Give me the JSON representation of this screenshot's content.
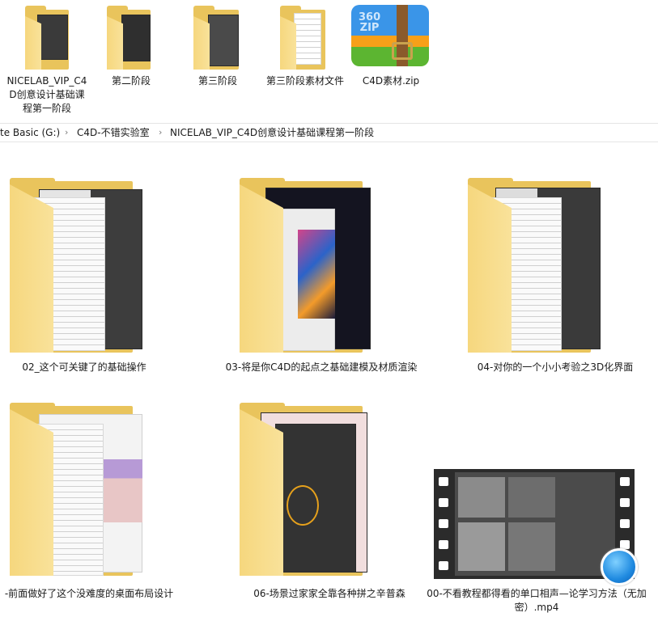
{
  "top_items": [
    {
      "label": "NICELAB_VIP_C4D创意设计基础课程第一阶段",
      "icon": "folder-icon"
    },
    {
      "label": "第二阶段",
      "icon": "folder-icon"
    },
    {
      "label": "第三阶段",
      "icon": "folder-icon"
    },
    {
      "label": "第三阶段素材文件",
      "icon": "folder-icon"
    },
    {
      "label": "C4D素材.zip",
      "icon": "zip-archive-icon"
    }
  ],
  "breadcrumb": {
    "drive": "te Basic (G:)",
    "folder1": "C4D-不错实验室",
    "folder2": "NICELAB_VIP_C4D创意设计基础课程第一阶段",
    "separator": "›"
  },
  "items": [
    {
      "label": "02_这个可关键了的基础操作",
      "icon": "folder-icon"
    },
    {
      "label": "03-将是你C4D的起点之基础建模及材质渲染",
      "icon": "folder-icon"
    },
    {
      "label": "04-对你的一个小小考验之3D化界面",
      "icon": "folder-icon"
    },
    {
      "label": "-前面做好了这个没难度的桌面布局设计",
      "icon": "folder-icon"
    },
    {
      "label": "06-场景过家家全靠各种拼之辛普森",
      "icon": "folder-icon"
    },
    {
      "label": "00-不看教程都得看的单口相声—论学习方法（无加密）.mp4",
      "icon": "video-file-icon"
    }
  ],
  "zip_badge": "360\nZIP",
  "colors": {
    "folder": "#e9c45c",
    "folder_front": "#f8df91",
    "zip_green": "#5cb531",
    "zip_blue": "#2f8de4",
    "zip_orange": "#f7a019"
  }
}
